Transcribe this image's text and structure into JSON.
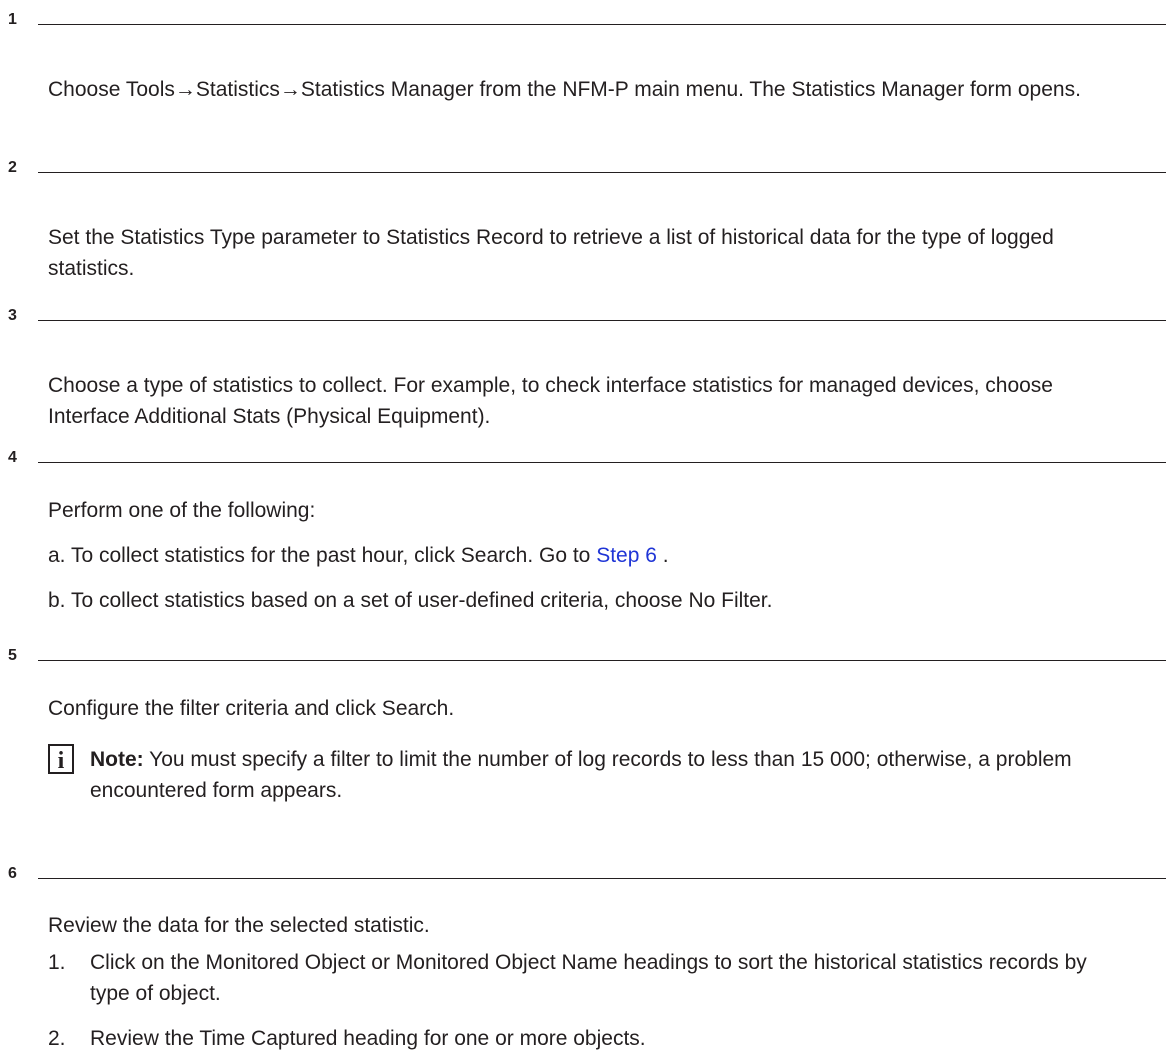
{
  "steps": [
    {
      "num": "1",
      "text": "Choose Tools→Statistics→Statistics Manager from the NFM-P main menu. The Statistics Manager form opens."
    },
    {
      "num": "2",
      "text": "Set the Statistics Type parameter to Statistics Record to retrieve a list of historical data for the type of logged statistics."
    },
    {
      "num": "3",
      "text": "Choose a type of statistics to collect. For example, to check interface statistics for managed devices, choose Interface Additional Stats (Physical Equipment)."
    },
    {
      "num": "4",
      "intro": "Perform one of the following:",
      "a_text": "a. To collect statistics for the past hour, click Search. Go to ",
      "a_link": "Step 6",
      "a_end": " .",
      "b_text": "b. To collect statistics based on a set of user-defined criteria, choose No Filter."
    },
    {
      "num": "5",
      "text": "Configure the filter criteria and click Search.",
      "note_icon": "i",
      "note_label": "Note:",
      "note_text": " You must specify a filter to limit the number of log records to less than 15 000; otherwise, a problem encountered form appears."
    },
    {
      "num": "6",
      "text": "Review the data for the selected statistic.",
      "items": [
        {
          "n": "1.",
          "text": "Click on the Monitored Object or Monitored Object Name headings to sort the historical statistics records by type of object."
        },
        {
          "n": "2.",
          "text": "Review the Time Captured heading for one or more objects."
        }
      ]
    }
  ],
  "colors": {
    "text": "#231f20",
    "link": "#1f35d6"
  }
}
